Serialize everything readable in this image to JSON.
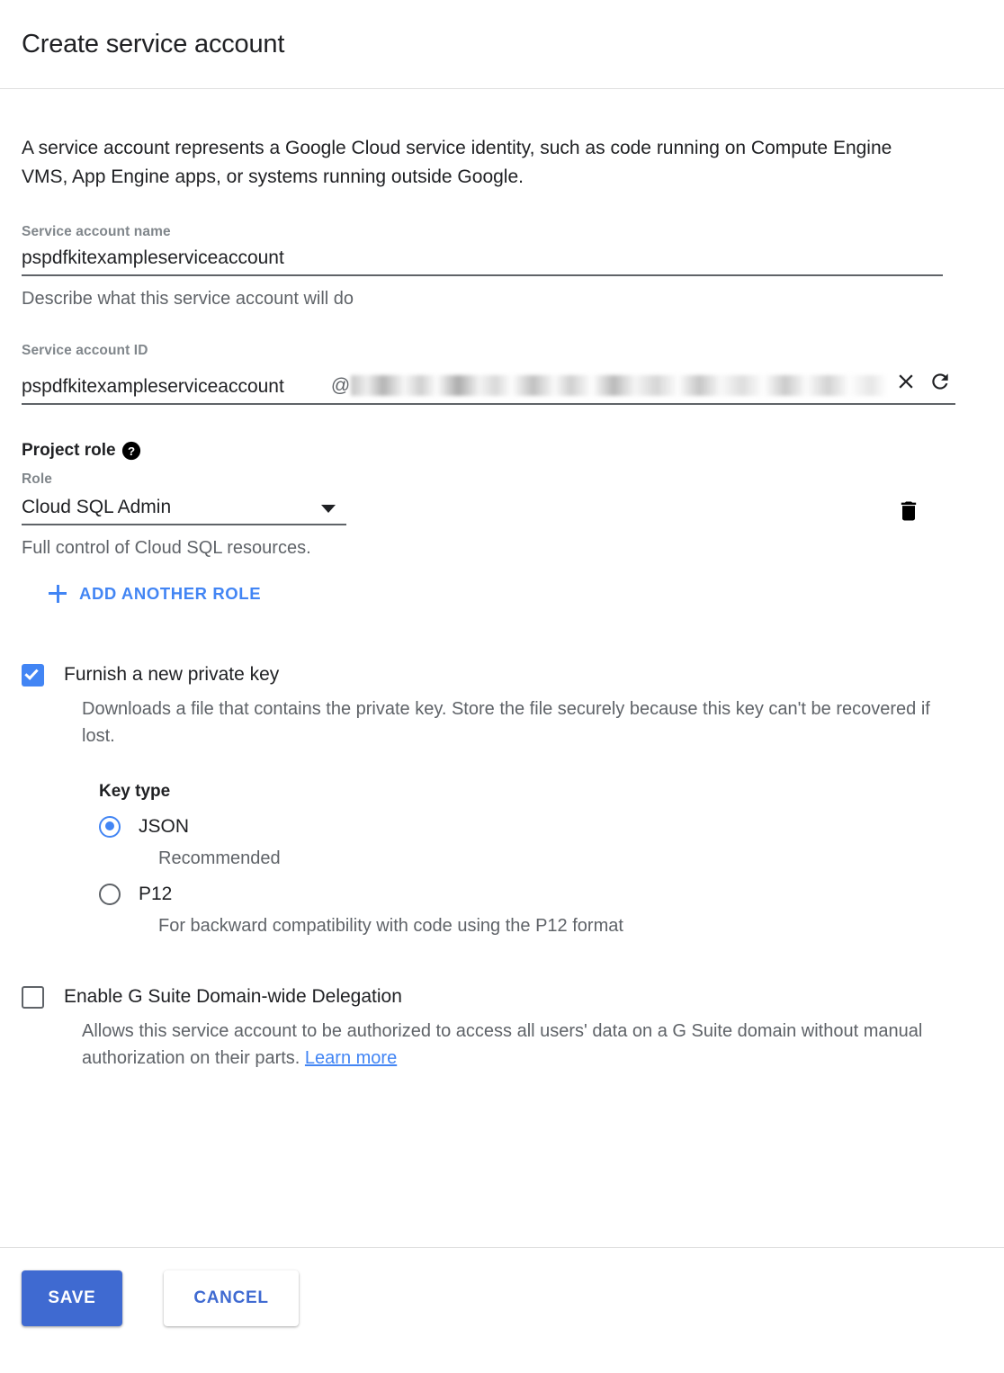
{
  "header": {
    "title": "Create service account"
  },
  "intro": {
    "text": "A service account represents a Google Cloud service identity, such as code running on Compute Engine VMS, App Engine apps, or systems running outside Google."
  },
  "form": {
    "name_field": {
      "label": "Service account name",
      "value": "pspdfkitexampleserviceaccount",
      "hint": "Describe what this service account will do"
    },
    "id_field": {
      "label": "Service account ID",
      "value": "pspdfkitexampleserviceaccount",
      "at_symbol": "@",
      "domain_value": "",
      "clear_icon": "close-icon",
      "refresh_icon": "refresh-icon"
    },
    "project_role": {
      "heading": "Project role",
      "help_icon": "help-icon",
      "role_label": "Role",
      "selected_role": "Cloud SQL Admin",
      "dropdown_icon": "chevron-down-icon",
      "delete_icon": "trash-icon",
      "role_description": "Full control of Cloud SQL resources.",
      "add_role_label": "ADD ANOTHER ROLE",
      "add_role_icon": "plus-icon"
    },
    "private_key": {
      "checked": true,
      "label": "Furnish a new private key",
      "description": "Downloads a file that contains the private key. Store the file securely because this key can't be recovered if lost.",
      "key_type": {
        "title": "Key type",
        "selected": "JSON",
        "options": [
          {
            "label": "JSON",
            "description": "Recommended",
            "selected": true
          },
          {
            "label": "P12",
            "description": "For backward compatibility with code using the P12 format",
            "selected": false
          }
        ]
      }
    },
    "gsuite_delegation": {
      "checked": false,
      "label": "Enable G Suite Domain-wide Delegation",
      "description_before_link": "Allows this service account to be authorized to access all users' data on a G Suite domain without manual authorization on their parts. ",
      "link_label": "Learn more"
    }
  },
  "footer": {
    "save_label": "SAVE",
    "cancel_label": "CANCEL"
  },
  "colors": {
    "accent_blue": "#4285f4",
    "save_button_blue": "#3f6ad1",
    "text_primary": "#202124",
    "text_secondary": "#5f6368",
    "label_grey": "#80868b",
    "divider": "#e0e0e0"
  }
}
